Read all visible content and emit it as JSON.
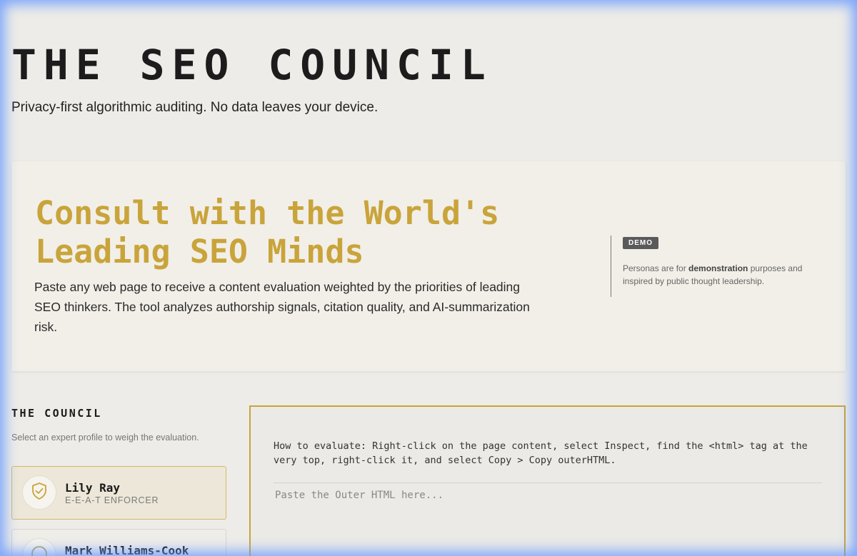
{
  "header": {
    "title": "THE SEO COUNCIL",
    "tagline": "Privacy-first algorithmic auditing. No data leaves your device."
  },
  "hero": {
    "title": "Consult with the World's Leading SEO Minds",
    "description": "Paste any web page to receive a content evaluation weighted by the priorities of leading SEO thinkers. The tool analyzes authorship signals, citation quality, and AI-summarization risk.",
    "badge": "DEMO",
    "note_prefix": "Personas are for ",
    "note_bold": "demonstration",
    "note_suffix": " purposes and inspired by public thought leadership."
  },
  "council": {
    "heading": "THE COUNCIL",
    "subtitle": "Select an expert profile to weigh the evaluation.",
    "personas": [
      {
        "name": "Lily Ray",
        "role": "E-E-A-T ENFORCER",
        "icon": "shield-check-icon",
        "selected": true
      },
      {
        "name": "Mark Williams-Cook",
        "role": "",
        "icon": "circle-icon",
        "selected": false
      }
    ]
  },
  "evaluation": {
    "instructions": "How to evaluate: Right-click on the page content, select Inspect, find the <html> tag at the very top, right-click it, and select Copy > Copy outerHTML.",
    "input_placeholder": "Paste the Outer HTML here...",
    "input_value": ""
  },
  "colors": {
    "accent_gold": "#c9a43b",
    "focus_glow": "#6496ff"
  }
}
